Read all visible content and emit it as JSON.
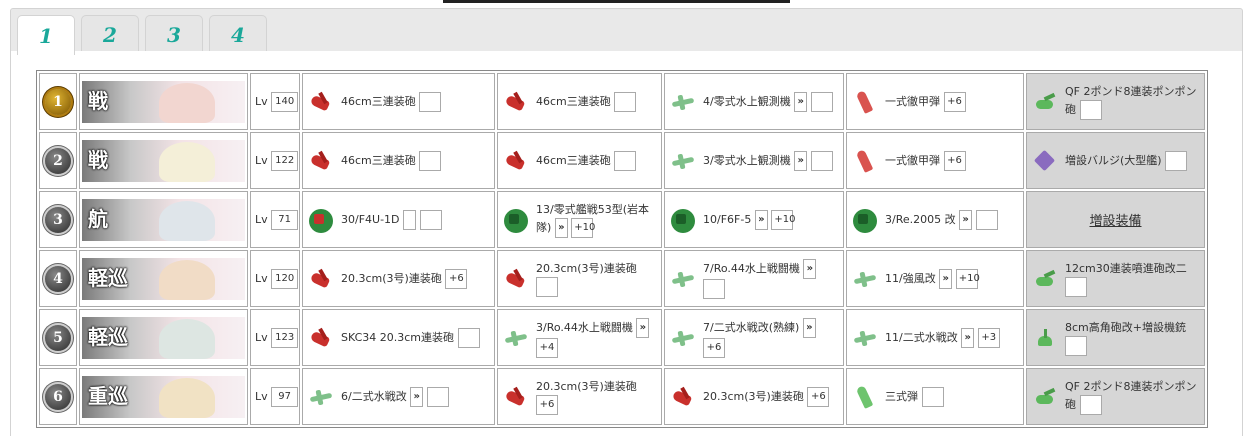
{
  "tabs": [
    "1",
    "2",
    "3",
    "4"
  ],
  "fleet": [
    {
      "num": "1",
      "flag": true,
      "cls": "戦",
      "face": "#f2d6d0",
      "lv": "140",
      "eq": [
        {
          "icon": "gun-red",
          "name": "46cm三連装砲",
          "boxes": [
            "cell"
          ]
        },
        {
          "icon": "gun-red",
          "name": "46cm三連装砲",
          "boxes": [
            "cell"
          ]
        },
        {
          "icon": "plane",
          "name": "4/零式水上観測機",
          "boxes": [
            "btn:»",
            "cell"
          ]
        },
        {
          "icon": "shell",
          "name": "一式徹甲弾",
          "boxes": [
            "ap:+6"
          ]
        }
      ],
      "ex": {
        "icon": "gun-green",
        "name": "QF 2ポンド8連装ポンポン砲",
        "boxes": [
          "cell"
        ]
      }
    },
    {
      "num": "2",
      "flag": false,
      "cls": "戦",
      "face": "#f4efd8",
      "lv": "122",
      "eq": [
        {
          "icon": "gun-red",
          "name": "46cm三連装砲",
          "boxes": [
            "cell"
          ]
        },
        {
          "icon": "gun-red",
          "name": "46cm三連装砲",
          "boxes": [
            "cell"
          ]
        },
        {
          "icon": "plane",
          "name": "3/零式水上観測機",
          "boxes": [
            "btn:»",
            "cell"
          ]
        },
        {
          "icon": "shell",
          "name": "一式徹甲弾",
          "boxes": [
            "ap:+6"
          ]
        }
      ],
      "ex": {
        "icon": "bulge",
        "name": "増設バルジ(大型艦)",
        "boxes": [
          "cell"
        ]
      }
    },
    {
      "num": "3",
      "flag": false,
      "cls": "航",
      "face": "#dfe5ea",
      "lv": "71",
      "eq": [
        {
          "icon": "fighter-red",
          "name": "30/F4U-1D",
          "boxes": [
            "btn:",
            "cell"
          ]
        },
        {
          "icon": "fighter",
          "name": "13/零式艦戦53型(岩本隊)",
          "boxes": [
            "btn:»",
            "ap:+10"
          ]
        },
        {
          "icon": "fighter",
          "name": "10/F6F-5",
          "boxes": [
            "btn:»",
            "ap:+10"
          ]
        },
        {
          "icon": "fighter",
          "name": "3/Re.2005 改",
          "boxes": [
            "btn:»",
            "cell"
          ]
        }
      ],
      "ex": {
        "link": "増設装備"
      }
    },
    {
      "num": "4",
      "flag": false,
      "cls": "軽巡",
      "face": "#f1dcc6",
      "lv": "120",
      "eq": [
        {
          "icon": "gun-red",
          "name": "20.3cm(3号)連装砲",
          "boxes": [
            "ap:+6"
          ]
        },
        {
          "icon": "gun-red",
          "name": "20.3cm(3号)連装砲",
          "boxes": [
            "cell"
          ]
        },
        {
          "icon": "plane",
          "name": "7/Ro.44水上戦闘機",
          "boxes": [
            "btn:»",
            "cell"
          ]
        },
        {
          "icon": "plane",
          "name": "11/強風改",
          "boxes": [
            "btn:»",
            "ap:+10"
          ]
        }
      ],
      "ex": {
        "icon": "gun-green",
        "name": "12cm30連装噴進砲改二",
        "boxes": [
          "cell"
        ]
      }
    },
    {
      "num": "5",
      "flag": false,
      "cls": "軽巡",
      "face": "#dde6e2",
      "lv": "123",
      "eq": [
        {
          "icon": "gun-red",
          "name": "SKC34 20.3cm連装砲",
          "boxes": [
            "cell"
          ]
        },
        {
          "icon": "plane",
          "name": "3/Ro.44水上戦闘機",
          "boxes": [
            "btn:»",
            "ap:+4"
          ]
        },
        {
          "icon": "plane",
          "name": "7/二式水戦改(熟練)",
          "boxes": [
            "btn:»",
            "ap:+6"
          ]
        },
        {
          "icon": "plane",
          "name": "11/二式水戦改",
          "boxes": [
            "btn:»",
            "ap:+3"
          ]
        }
      ],
      "ex": {
        "icon": "aa",
        "name": "8cm高角砲改+増設機銃",
        "boxes": [
          "cell"
        ]
      }
    },
    {
      "num": "6",
      "flag": false,
      "cls": "重巡",
      "face": "#f1e2c4",
      "lv": "97",
      "eq": [
        {
          "icon": "plane",
          "name": "6/二式水戦改",
          "boxes": [
            "btn:»",
            "cell"
          ]
        },
        {
          "icon": "gun-red",
          "name": "20.3cm(3号)連装砲",
          "boxes": [
            "ap:+6"
          ]
        },
        {
          "icon": "gun-red",
          "name": "20.3cm(3号)連装砲",
          "boxes": [
            "ap:+6"
          ]
        },
        {
          "icon": "shell-green",
          "name": "三式弾",
          "boxes": [
            "cell"
          ]
        }
      ],
      "ex": {
        "icon": "gun-green",
        "name": "QF 2ポンド8連装ポンポン砲",
        "boxes": [
          "cell"
        ]
      }
    }
  ]
}
